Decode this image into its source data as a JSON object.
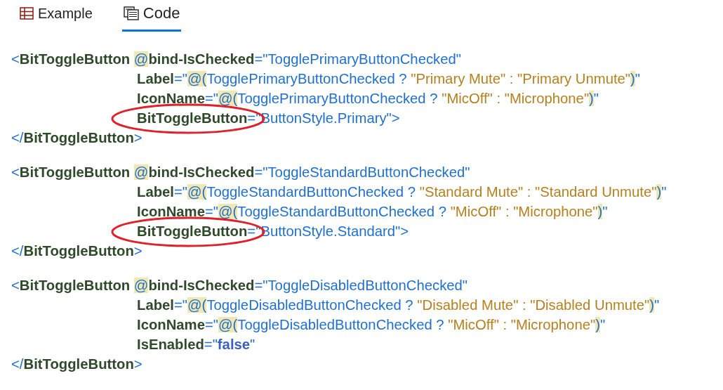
{
  "tabs": [
    {
      "label": "Example",
      "selected": false
    },
    {
      "label": "Code",
      "selected": true
    }
  ],
  "code_blocks": [
    {
      "lines": [
        {
          "circled": false,
          "tokens": [
            {
              "kind": "punct",
              "text": "<"
            },
            {
              "kind": "name",
              "text": "BitToggleButton "
            },
            {
              "kind": "razor",
              "text": "@"
            },
            {
              "kind": "name",
              "text": "bind-IsChecked"
            },
            {
              "kind": "punct",
              "text": "=\""
            },
            {
              "kind": "expr",
              "text": "TogglePrimaryButtonChecked"
            },
            {
              "kind": "punct",
              "text": "\""
            }
          ],
          "children": [
            {
              "circled": false,
              "tokens": [
                {
                  "kind": "name",
                  "text": "Label"
                },
                {
                  "kind": "punct",
                  "text": "=\""
                },
                {
                  "kind": "razor",
                  "text": "@("
                },
                {
                  "kind": "expr",
                  "text": "TogglePrimaryButtonChecked ? "
                },
                {
                  "kind": "string",
                  "text": "\"Primary Mute\" : \"Primary Unmute\""
                },
                {
                  "kind": "razor",
                  "text": ")"
                },
                {
                  "kind": "punct",
                  "text": "\""
                }
              ]
            },
            {
              "circled": false,
              "tokens": [
                {
                  "kind": "name",
                  "text": "IconName"
                },
                {
                  "kind": "punct",
                  "text": "=\""
                },
                {
                  "kind": "razor",
                  "text": "@("
                },
                {
                  "kind": "expr",
                  "text": "TogglePrimaryButtonChecked ? "
                },
                {
                  "kind": "string",
                  "text": "\"MicOff\" : \"Microphone\""
                },
                {
                  "kind": "razor",
                  "text": ")"
                },
                {
                  "kind": "punct",
                  "text": "\""
                }
              ]
            },
            {
              "circled": true,
              "tokens": [
                {
                  "kind": "name",
                  "text": "BitToggleButton"
                },
                {
                  "kind": "punct",
                  "text": "=\""
                },
                {
                  "kind": "expr",
                  "text": "ButtonStyle.Primary"
                },
                {
                  "kind": "punct",
                  "text": "\">"
                }
              ]
            }
          ]
        },
        {
          "circled": false,
          "tokens": [
            {
              "kind": "punct",
              "text": "</"
            },
            {
              "kind": "name",
              "text": "BitToggleButton"
            },
            {
              "kind": "punct",
              "text": ">"
            }
          ]
        }
      ]
    },
    {
      "lines": [
        {
          "circled": false,
          "tokens": [
            {
              "kind": "punct",
              "text": "<"
            },
            {
              "kind": "name",
              "text": "BitToggleButton "
            },
            {
              "kind": "razor",
              "text": "@"
            },
            {
              "kind": "name",
              "text": "bind-IsChecked"
            },
            {
              "kind": "punct",
              "text": "=\""
            },
            {
              "kind": "expr",
              "text": "ToggleStandardButtonChecked"
            },
            {
              "kind": "punct",
              "text": "\""
            }
          ],
          "children": [
            {
              "circled": false,
              "tokens": [
                {
                  "kind": "name",
                  "text": "Label"
                },
                {
                  "kind": "punct",
                  "text": "=\""
                },
                {
                  "kind": "razor",
                  "text": "@("
                },
                {
                  "kind": "expr",
                  "text": "ToggleStandardButtonChecked ? "
                },
                {
                  "kind": "string",
                  "text": "\"Standard Mute\" : \"Standard Unmute\""
                },
                {
                  "kind": "razor",
                  "text": ")"
                },
                {
                  "kind": "punct",
                  "text": "\""
                }
              ]
            },
            {
              "circled": false,
              "tokens": [
                {
                  "kind": "name",
                  "text": "IconName"
                },
                {
                  "kind": "punct",
                  "text": "=\""
                },
                {
                  "kind": "razor",
                  "text": "@("
                },
                {
                  "kind": "expr",
                  "text": "ToggleStandardButtonChecked ? "
                },
                {
                  "kind": "string",
                  "text": "\"MicOff\" : \"Microphone\""
                },
                {
                  "kind": "razor",
                  "text": ")"
                },
                {
                  "kind": "punct",
                  "text": "\""
                }
              ]
            },
            {
              "circled": true,
              "tokens": [
                {
                  "kind": "name",
                  "text": "BitToggleButton"
                },
                {
                  "kind": "punct",
                  "text": "=\""
                },
                {
                  "kind": "expr",
                  "text": "ButtonStyle.Standard"
                },
                {
                  "kind": "punct",
                  "text": "\">"
                }
              ]
            }
          ]
        },
        {
          "circled": false,
          "tokens": [
            {
              "kind": "punct",
              "text": "</"
            },
            {
              "kind": "name",
              "text": "BitToggleButton"
            },
            {
              "kind": "punct",
              "text": ">"
            }
          ]
        }
      ]
    },
    {
      "lines": [
        {
          "circled": false,
          "tokens": [
            {
              "kind": "punct",
              "text": "<"
            },
            {
              "kind": "name",
              "text": "BitToggleButton "
            },
            {
              "kind": "razor",
              "text": "@"
            },
            {
              "kind": "name",
              "text": "bind-IsChecked"
            },
            {
              "kind": "punct",
              "text": "=\""
            },
            {
              "kind": "expr",
              "text": "ToggleDisabledButtonChecked"
            },
            {
              "kind": "punct",
              "text": "\""
            }
          ],
          "children": [
            {
              "circled": false,
              "tokens": [
                {
                  "kind": "name",
                  "text": "Label"
                },
                {
                  "kind": "punct",
                  "text": "=\""
                },
                {
                  "kind": "razor",
                  "text": "@("
                },
                {
                  "kind": "expr",
                  "text": "ToggleDisabledButtonChecked ? "
                },
                {
                  "kind": "string",
                  "text": "\"Disabled Mute\" : \"Disabled Unmute\""
                },
                {
                  "kind": "razor",
                  "text": ")"
                },
                {
                  "kind": "punct",
                  "text": "\""
                }
              ]
            },
            {
              "circled": false,
              "tokens": [
                {
                  "kind": "name",
                  "text": "IconName"
                },
                {
                  "kind": "punct",
                  "text": "=\""
                },
                {
                  "kind": "razor",
                  "text": "@("
                },
                {
                  "kind": "expr",
                  "text": "ToggleDisabledButtonChecked ? "
                },
                {
                  "kind": "string",
                  "text": "\"MicOff\" : \"Microphone\""
                },
                {
                  "kind": "razor",
                  "text": ")"
                },
                {
                  "kind": "punct",
                  "text": "\""
                }
              ]
            },
            {
              "circled": false,
              "tokens": [
                {
                  "kind": "name",
                  "text": "IsEnabled"
                },
                {
                  "kind": "punct",
                  "text": "=\""
                },
                {
                  "kind": "keyword",
                  "text": "false"
                },
                {
                  "kind": "punct",
                  "text": "\""
                }
              ]
            }
          ]
        },
        {
          "circled": false,
          "tokens": [
            {
              "kind": "punct",
              "text": "</"
            },
            {
              "kind": "name",
              "text": "BitToggleButton"
            },
            {
              "kind": "punct",
              "text": ">"
            }
          ]
        }
      ]
    }
  ]
}
